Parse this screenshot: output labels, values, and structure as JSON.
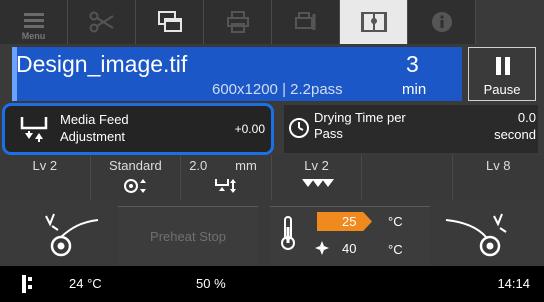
{
  "toolbar": {
    "menu_label": "Menu",
    "buttons": [
      "menu",
      "cut",
      "windows",
      "print-settings",
      "printer-maintenance",
      "book",
      "info"
    ]
  },
  "job": {
    "file_name": "Design_image.tif",
    "detail": "600x1200 | 2.2pass",
    "remaining_value": "3",
    "remaining_unit": "min"
  },
  "pause": {
    "label": "Pause"
  },
  "media_feed": {
    "label_line1": "Media Feed",
    "label_line2": "Adjustment",
    "value": "+0.00"
  },
  "drying": {
    "label_line1": "Drying Time per",
    "label_line2": "Pass",
    "value": "0.0",
    "unit": "second"
  },
  "levels": [
    {
      "top": "Lv 2",
      "icon": "feed-icon"
    },
    {
      "top": "Standard",
      "icon": "platen-gap-icon"
    },
    {
      "top": "2.0",
      "unit": "mm",
      "icon": "head-height-icon"
    },
    {
      "top": "Lv 2",
      "icon": "tension-icon"
    },
    {
      "top": "",
      "icon": "empty"
    },
    {
      "top": "Lv 8",
      "icon": "takeup-icon"
    }
  ],
  "heater": {
    "preheat_label": "Preheat Stop",
    "temp_value": "25",
    "temp_unit": "°C",
    "fan_value": "40",
    "fan_unit": "°C"
  },
  "status": {
    "ambient_temp": "24 °C",
    "humidity": "50 %",
    "time": "14:14"
  },
  "colors": {
    "accent_blue": "#1b57c7",
    "highlight_blue": "#1d6fe6",
    "heater_orange": "#f08a1e"
  }
}
